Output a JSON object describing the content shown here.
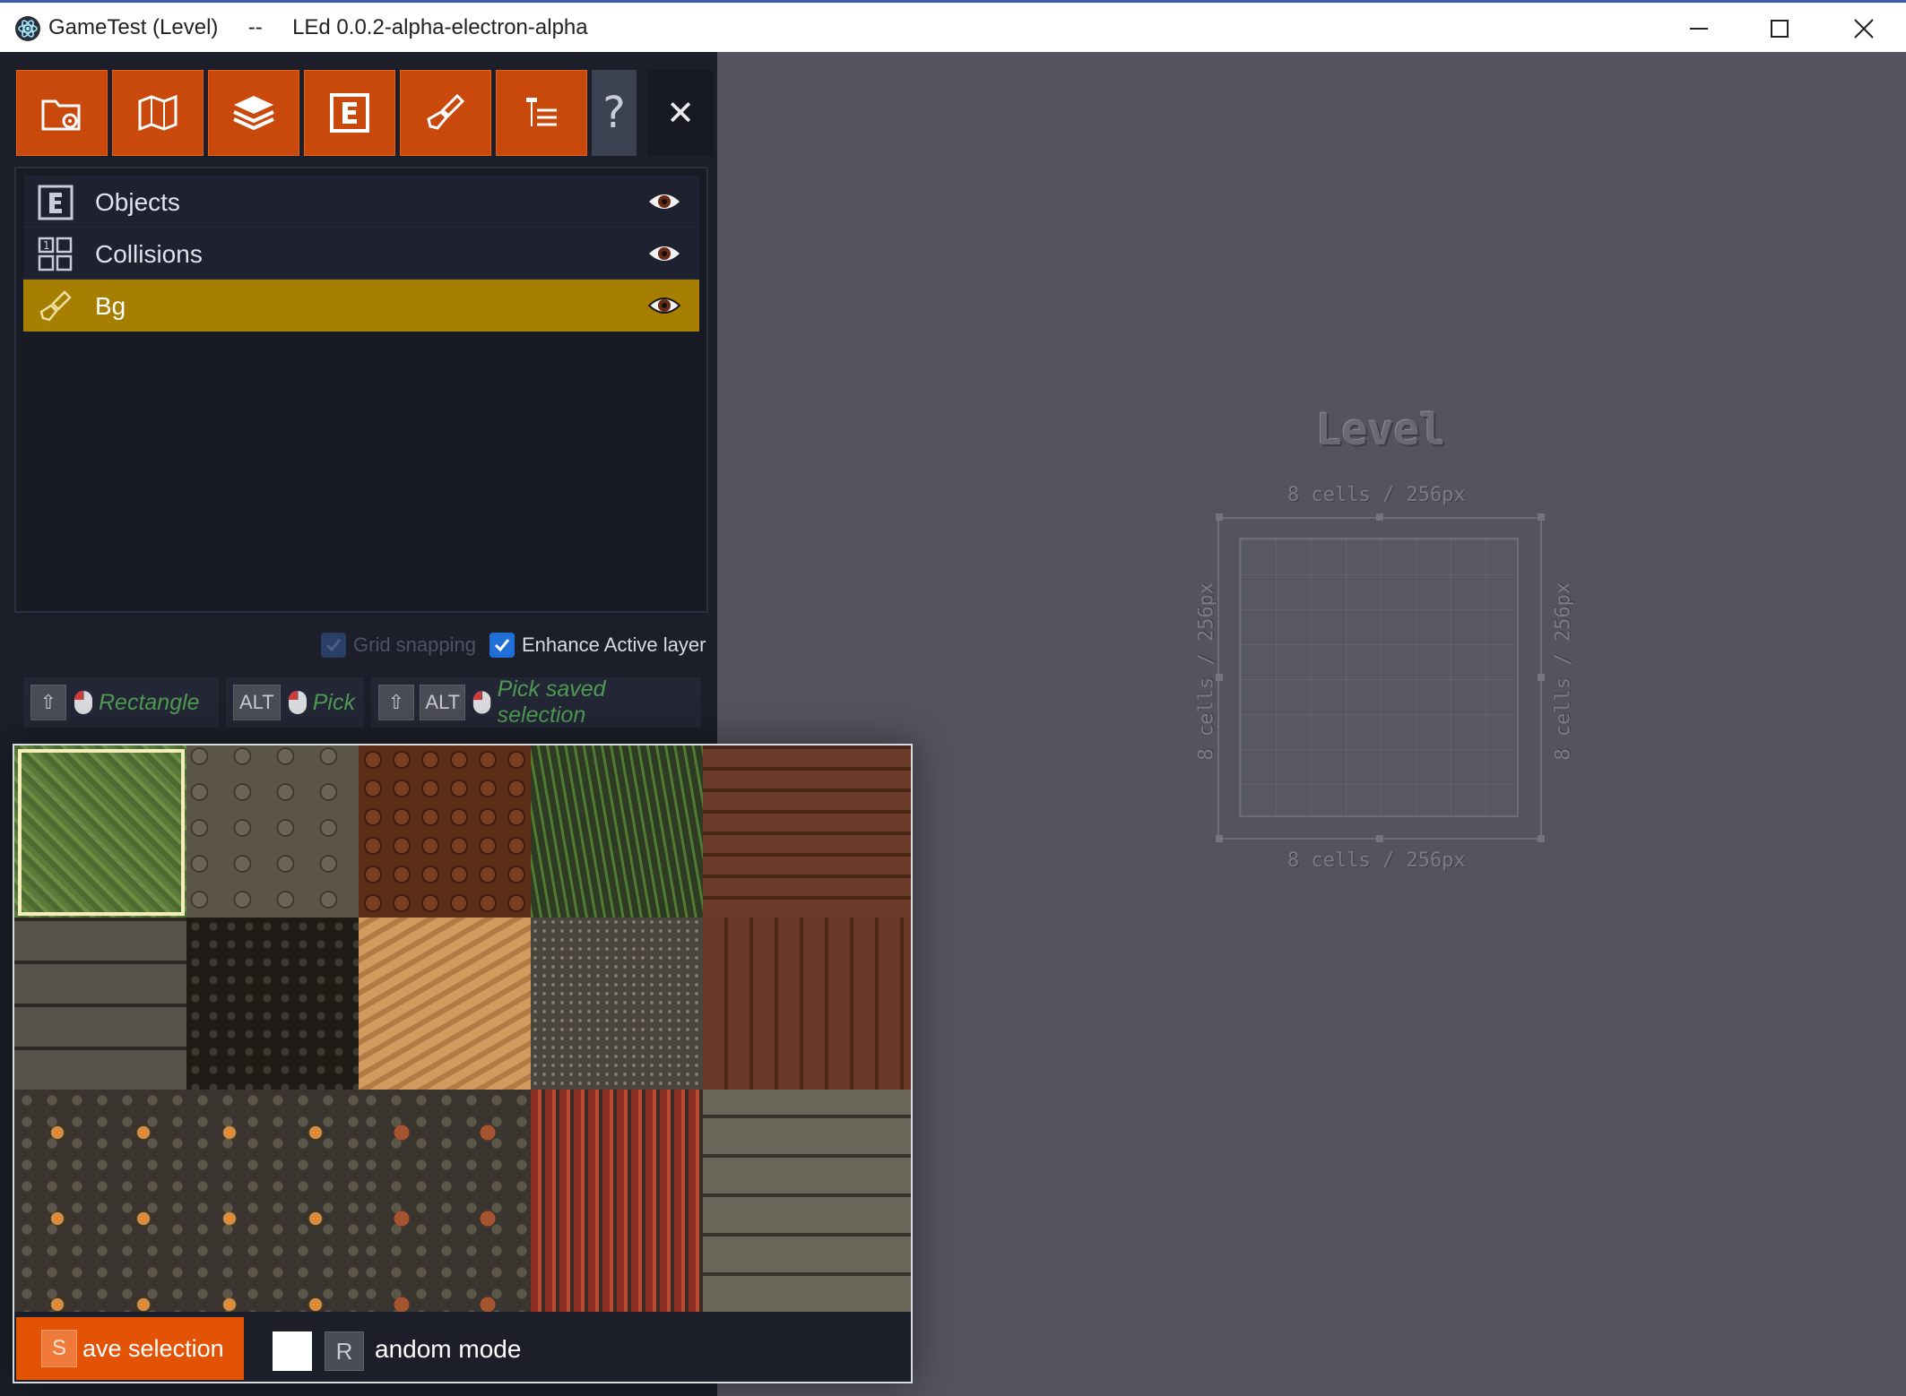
{
  "window": {
    "title": "GameTest (Level)     --     LEd 0.0.2-alpha-electron-alpha",
    "controls": [
      "minimize",
      "maximize",
      "close"
    ]
  },
  "toolbar": {
    "buttons": [
      {
        "name": "project-settings",
        "icon": "folder-gear-icon"
      },
      {
        "name": "world-map",
        "icon": "map-icon"
      },
      {
        "name": "layers",
        "icon": "layers-icon"
      },
      {
        "name": "entities",
        "icon": "entity-e-icon"
      },
      {
        "name": "tilesets",
        "icon": "paint-brush-icon"
      },
      {
        "name": "enums",
        "icon": "enum-list-icon"
      }
    ],
    "help_label": "?",
    "close_label": "✕"
  },
  "layers": [
    {
      "name": "Objects",
      "type": "entity",
      "icon": "entity-e-icon",
      "visible": true,
      "active": false
    },
    {
      "name": "Collisions",
      "type": "intgrid",
      "icon": "intgrid-icon",
      "visible": true,
      "active": false
    },
    {
      "name": "Bg",
      "type": "tiles",
      "icon": "paint-brush-icon",
      "visible": true,
      "active": true
    }
  ],
  "options": {
    "grid_snapping": {
      "label": "Grid snapping",
      "checked": true,
      "disabled": true
    },
    "enhance_active": {
      "label": "Enhance Active layer",
      "checked": true,
      "disabled": false
    }
  },
  "shortcuts": [
    {
      "keys": [
        "⇧"
      ],
      "label": "Rectangle"
    },
    {
      "keys": [
        "ALT"
      ],
      "label": "Pick"
    },
    {
      "keys": [
        "⇧",
        "ALT"
      ],
      "label": "Pick saved selection"
    }
  ],
  "tileset": {
    "save_key": "S",
    "save_label": "ave selection",
    "random_key": "R",
    "random_label": "andom mode",
    "random_checked": false
  },
  "level": {
    "name": "Level",
    "width_label": "8 cells / 256px",
    "height_label": "8 cells / 256px"
  },
  "colors": {
    "accent": "#c9480c",
    "active_layer": "#a67e00",
    "panel_bg": "#1c1f29",
    "canvas_bg": "#55535f",
    "shortcut_label": "#4e9a52"
  }
}
